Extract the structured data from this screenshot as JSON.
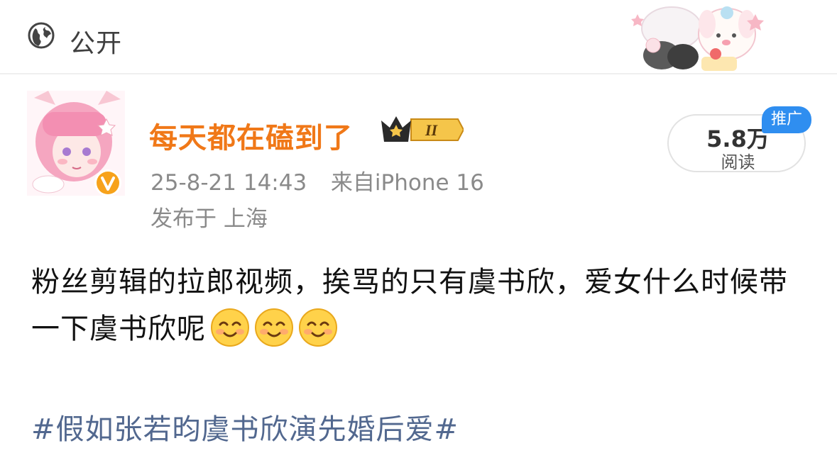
{
  "header": {
    "visibility_label": "公开",
    "globe_icon": "globe-icon"
  },
  "post": {
    "author_name": "每天都在磕到了",
    "member_badge_text": "II",
    "verified_badge_text": "V",
    "timestamp": "25-8-21 14:43",
    "source": "来自iPhone 16",
    "location": "发布于 上海",
    "read_count": "5.8万",
    "read_label": "阅读",
    "promo_label": "推广",
    "body_text": "粉丝剪辑的拉郎视频，挨骂的只有虞书欣，爱女什么时候带一下虞书欣呢",
    "emoji_count_icon": "smile-emoji-icon",
    "hashtag": "#假如张若昀虞书欣演先婚后爱#"
  },
  "colors": {
    "username": "#f07818",
    "hashtag": "#52688f",
    "promo": "#2f8ef0",
    "meta": "#8a8a8a"
  }
}
